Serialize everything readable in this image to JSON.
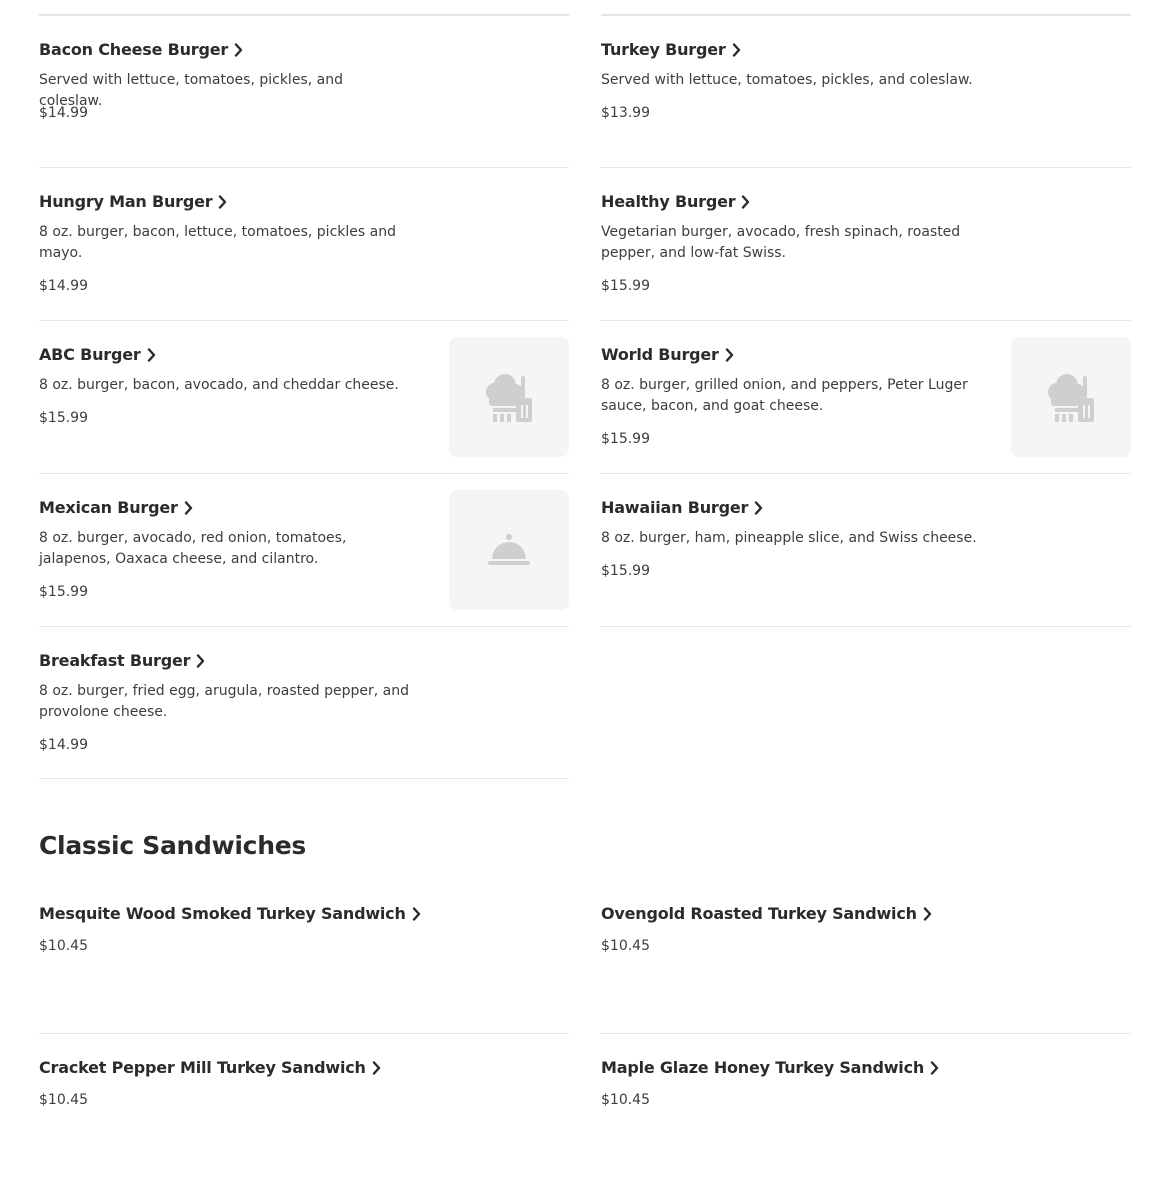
{
  "burgers": [
    {
      "name": "Bacon Cheese Burger",
      "description": "Served with lettuce, tomatoes, pickles, and coleslaw.",
      "price": "$14.99"
    },
    {
      "name": "Turkey Burger",
      "description": "Served with lettuce, tomatoes, pickles, and coleslaw.",
      "price": "$13.99"
    },
    {
      "name": "Hungry Man Burger",
      "description": "8 oz. burger, bacon, lettuce, tomatoes, pickles and mayo.",
      "price": "$14.99"
    },
    {
      "name": "Healthy Burger",
      "description": "Vegetarian burger, avocado, fresh spinach, roasted pepper, and low-fat Swiss.",
      "price": "$15.99"
    },
    {
      "name": "ABC Burger",
      "description": "8 oz. burger, bacon, avocado, and cheddar cheese.",
      "price": "$15.99",
      "image_icon": "chef-icon"
    },
    {
      "name": "World Burger",
      "description": "8 oz. burger, grilled onion, and peppers, Peter Luger sauce, bacon, and goat cheese.",
      "price": "$15.99",
      "image_icon": "chef-icon"
    },
    {
      "name": "Mexican Burger",
      "description": "8 oz. burger, avocado, red onion, tomatoes, jalapenos, Oaxaca cheese, and cilantro.",
      "price": "$15.99",
      "image_icon": "cloche-icon"
    },
    {
      "name": "Hawaiian Burger",
      "description": "8 oz. burger, ham, pineapple slice, and Swiss cheese.",
      "price": "$15.99"
    },
    {
      "name": "Breakfast Burger",
      "description": "8 oz. burger, fried egg, arugula, roasted pepper, and provolone cheese.",
      "price": "$14.99"
    }
  ],
  "sandwiches_section": {
    "title": "Classic Sandwiches",
    "items": [
      {
        "name": "Mesquite Wood Smoked Turkey Sandwich",
        "price": "$10.45"
      },
      {
        "name": "Ovengold Roasted Turkey Sandwich",
        "price": "$10.45"
      },
      {
        "name": "Cracket Pepper Mill Turkey Sandwich",
        "price": "$10.45"
      },
      {
        "name": "Maple Glaze Honey Turkey Sandwich",
        "price": "$10.45"
      }
    ]
  },
  "colors": {
    "text": "#2b2b2b",
    "divider": "#e6e6e6",
    "placeholder_bg": "#f5f5f5",
    "placeholder_icon": "#cfcfcf"
  }
}
